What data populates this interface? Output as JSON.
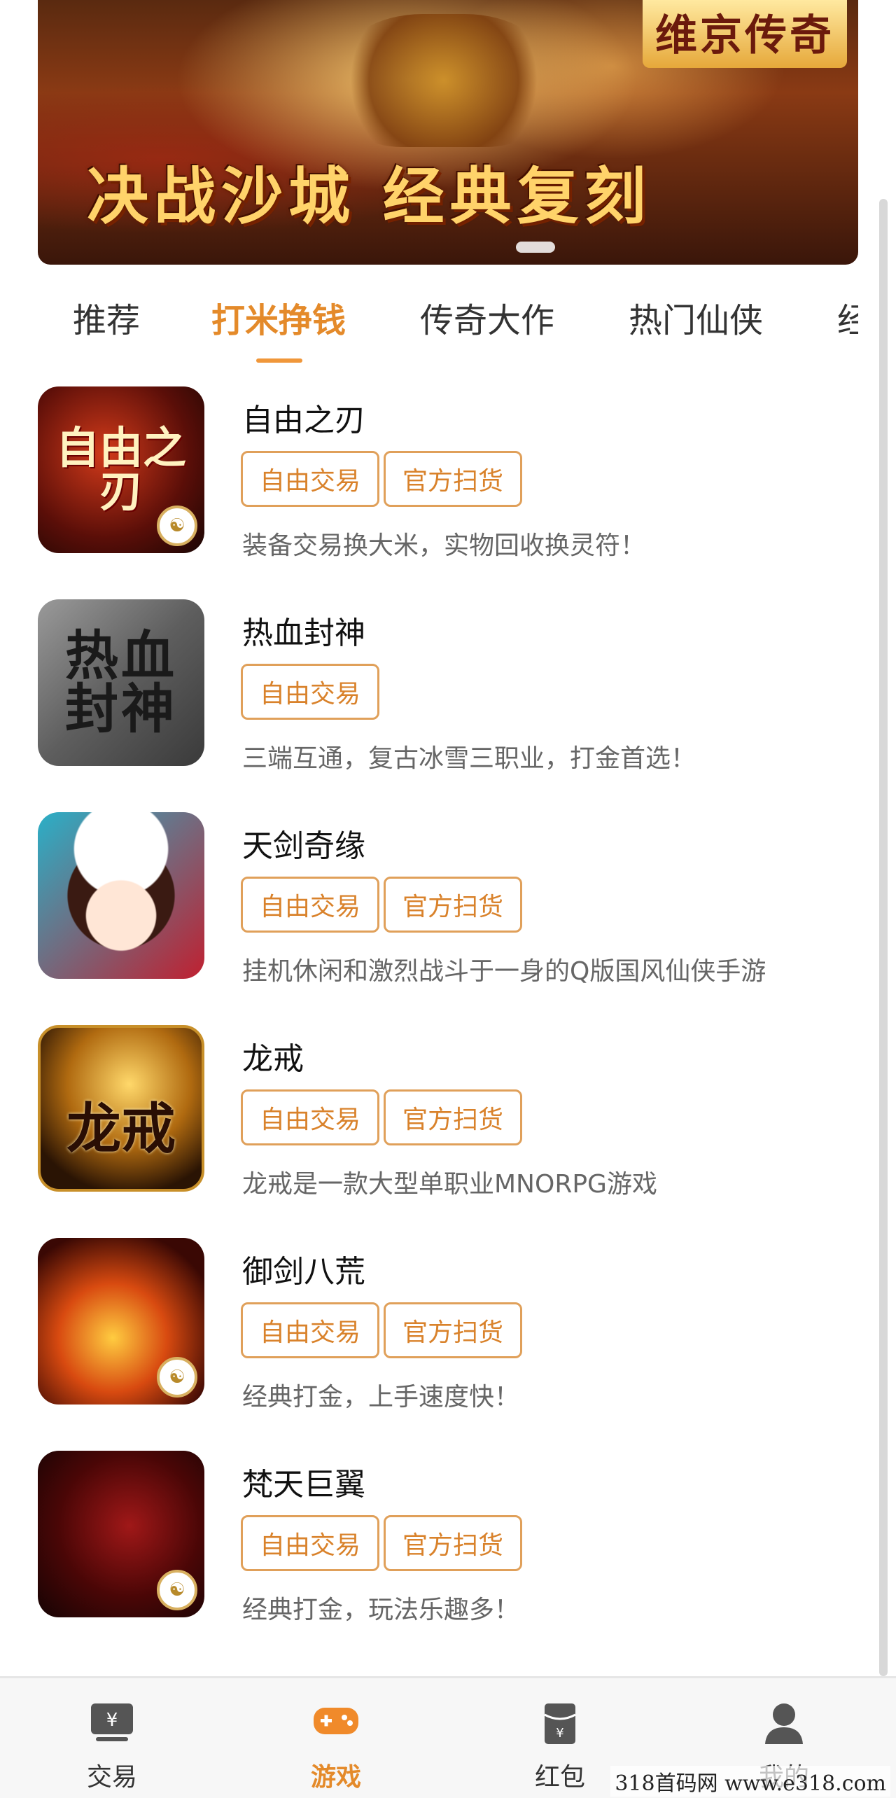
{
  "banner": {
    "brand_text": "维京传奇",
    "slogan": "决战沙城 经典复刻"
  },
  "tabs": [
    {
      "label": "推荐"
    },
    {
      "label": "打米挣钱"
    },
    {
      "label": "传奇大作"
    },
    {
      "label": "热门仙侠"
    },
    {
      "label": "经"
    }
  ],
  "active_tab": "打米挣钱",
  "games": [
    {
      "title": "自由之刃",
      "tags": [
        "自由交易",
        "官方扫货"
      ],
      "desc": "装备交易换大米，实物回收换灵符！",
      "icon_text": "自由之刃",
      "icon_name": "game-icon-ziyouzhiren"
    },
    {
      "title": "热血封神",
      "tags": [
        "自由交易"
      ],
      "desc": "三端互通，复古冰雪三职业，打金首选！",
      "icon_text": "热血封神",
      "icon_name": "game-icon-rexuefengshen"
    },
    {
      "title": "天剑奇缘",
      "tags": [
        "自由交易",
        "官方扫货"
      ],
      "desc": "挂机休闲和激烈战斗于一身的Q版国风仙侠手游",
      "icon_text": "",
      "icon_name": "game-icon-tianjianqiyuan"
    },
    {
      "title": "龙戒",
      "tags": [
        "自由交易",
        "官方扫货"
      ],
      "desc": "龙戒是一款大型单职业MNORPG游戏",
      "icon_text": "龙戒",
      "icon_name": "game-icon-longjie"
    },
    {
      "title": "御剑八荒",
      "tags": [
        "自由交易",
        "官方扫货"
      ],
      "desc": "经典打金，上手速度快！",
      "icon_text": "",
      "icon_name": "game-icon-yujianbahuang"
    },
    {
      "title": "梵天巨翼",
      "tags": [
        "自由交易",
        "官方扫货"
      ],
      "desc": "经典打金，玩法乐趣多！",
      "icon_text": "",
      "icon_name": "game-icon-fantianjuyi"
    }
  ],
  "bottom_nav": [
    {
      "label": "交易",
      "icon": "trade-icon"
    },
    {
      "label": "游戏",
      "icon": "gamepad-icon"
    },
    {
      "label": "红包",
      "icon": "red-packet-icon"
    },
    {
      "label": "我的",
      "icon": "user-icon"
    }
  ],
  "active_nav": "游戏",
  "watermark": "318首码网 www.e318.com",
  "colors": {
    "accent": "#e48a2a",
    "tag_border": "#e0a05a"
  }
}
